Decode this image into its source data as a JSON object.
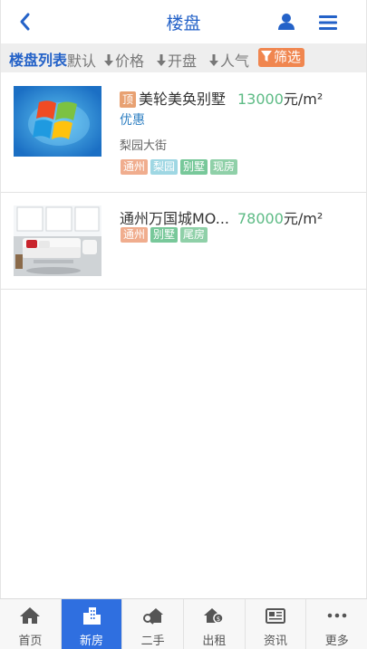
{
  "header": {
    "title": "楼盘",
    "back_icon": "chevron-left-icon",
    "user_icon": "user-icon",
    "menu_icon": "menu-icon",
    "accent_color": "#2462c8"
  },
  "filter_bar": {
    "list_title": "楼盘列表",
    "sorts": [
      {
        "label": "默认",
        "has_arrow": false
      },
      {
        "label": "价格",
        "has_arrow": true
      },
      {
        "label": "开盘",
        "has_arrow": true
      },
      {
        "label": "人气",
        "has_arrow": true
      }
    ],
    "filter_label": "筛选",
    "filter_icon": "funnel-icon",
    "filter_color": "#f0864f"
  },
  "listings": [
    {
      "badge": "顶",
      "name": "美轮美奂别墅",
      "price_value": "13000",
      "price_unit": "元/m²",
      "promo": "优惠",
      "address": "梨园大街",
      "image": "windows-logo-thumbnail",
      "tags": [
        {
          "label": "通州",
          "color": "#f0ad8e"
        },
        {
          "label": "梨园",
          "color": "#9fd7e3"
        },
        {
          "label": "别墅",
          "color": "#78c89a"
        },
        {
          "label": "现房",
          "color": "#8fd0a8"
        }
      ]
    },
    {
      "badge": "",
      "name": "通州万国城MO...",
      "price_value": "78000",
      "price_unit": "元/m²",
      "promo": "",
      "address": "",
      "image": "living-room-thumbnail",
      "tags": [
        {
          "label": "通州",
          "color": "#f0ad8e"
        },
        {
          "label": "别墅",
          "color": "#78c89a"
        },
        {
          "label": "尾房",
          "color": "#8fd0a8"
        }
      ]
    }
  ],
  "tabbar": {
    "active_color": "#2f6fe0",
    "tabs": [
      {
        "label": "首页",
        "icon": "home-icon",
        "active": false
      },
      {
        "label": "新房",
        "icon": "buildings-icon",
        "active": true
      },
      {
        "label": "二手",
        "icon": "house-search-icon",
        "active": false
      },
      {
        "label": "出租",
        "icon": "house-coin-icon",
        "active": false
      },
      {
        "label": "资讯",
        "icon": "newspaper-icon",
        "active": false
      },
      {
        "label": "更多",
        "icon": "more-dots-icon",
        "active": false
      }
    ]
  }
}
